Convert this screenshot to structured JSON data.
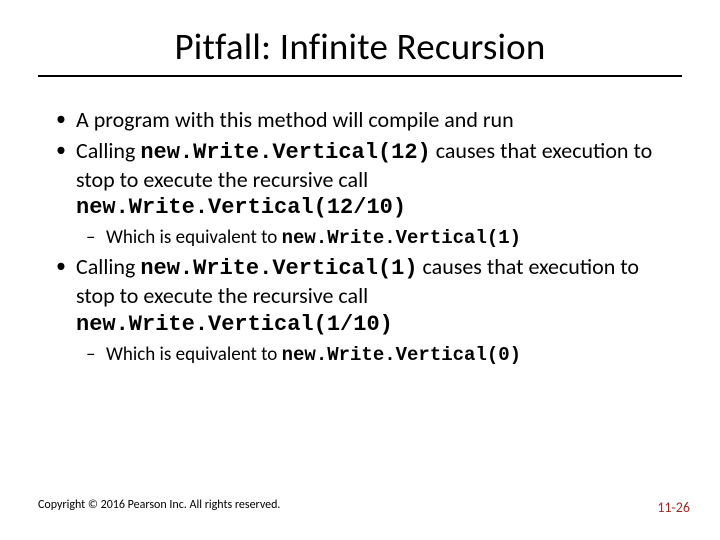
{
  "title": "Pitfall:  Infinite Recursion",
  "bullets": [
    {
      "pre": "A program with this method will compile and run"
    },
    {
      "pre": "Calling ",
      "code1": "new.Write.Vertical(12)",
      "mid": " causes that execution to stop to execute the recursive call ",
      "code2": "new.Write.Vertical(12/10)",
      "sub": {
        "pre": "Which is equivalent to ",
        "code": "new.Write.Vertical(1)"
      }
    },
    {
      "pre": "Calling ",
      "code1": "new.Write.Vertical(1)",
      "mid": " causes that execution to stop to execute the recursive call ",
      "code2": "new.Write.Vertical(1/10)",
      "sub": {
        "pre": "Which is equivalent to ",
        "code": "new.Write.Vertical(0)"
      }
    }
  ],
  "footer": "Copyright © 2016 Pearson Inc. All rights reserved.",
  "pagenum": "11-26"
}
